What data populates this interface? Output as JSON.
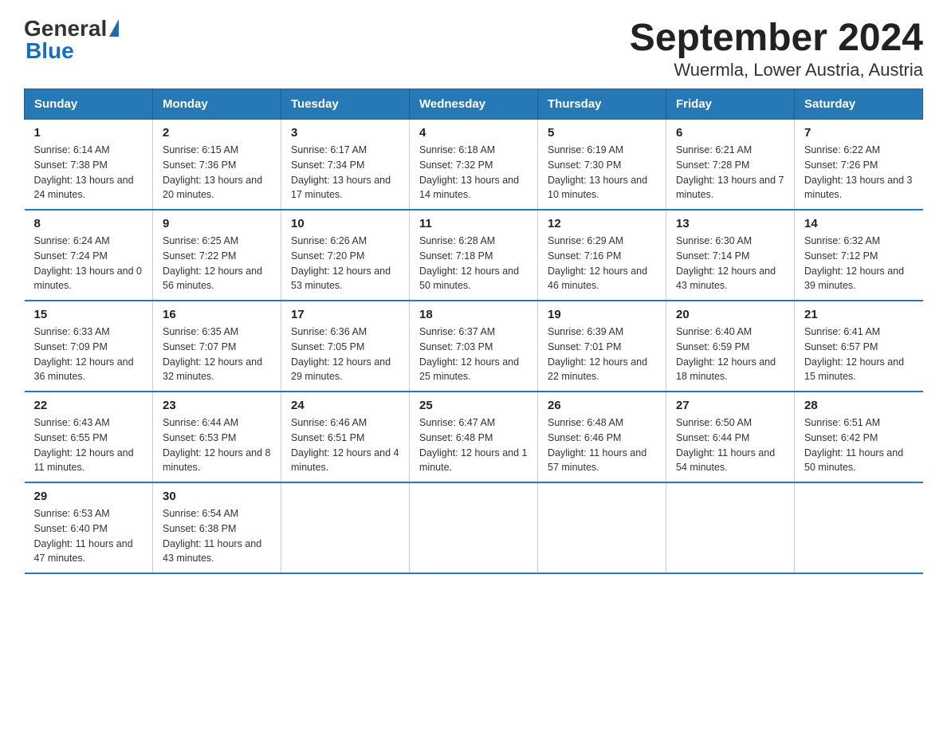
{
  "header": {
    "logo_general": "General",
    "logo_blue": "Blue",
    "title": "September 2024",
    "subtitle": "Wuermla, Lower Austria, Austria"
  },
  "days_of_week": [
    "Sunday",
    "Monday",
    "Tuesday",
    "Wednesday",
    "Thursday",
    "Friday",
    "Saturday"
  ],
  "weeks": [
    [
      {
        "day": "1",
        "sunrise": "Sunrise: 6:14 AM",
        "sunset": "Sunset: 7:38 PM",
        "daylight": "Daylight: 13 hours and 24 minutes."
      },
      {
        "day": "2",
        "sunrise": "Sunrise: 6:15 AM",
        "sunset": "Sunset: 7:36 PM",
        "daylight": "Daylight: 13 hours and 20 minutes."
      },
      {
        "day": "3",
        "sunrise": "Sunrise: 6:17 AM",
        "sunset": "Sunset: 7:34 PM",
        "daylight": "Daylight: 13 hours and 17 minutes."
      },
      {
        "day": "4",
        "sunrise": "Sunrise: 6:18 AM",
        "sunset": "Sunset: 7:32 PM",
        "daylight": "Daylight: 13 hours and 14 minutes."
      },
      {
        "day": "5",
        "sunrise": "Sunrise: 6:19 AM",
        "sunset": "Sunset: 7:30 PM",
        "daylight": "Daylight: 13 hours and 10 minutes."
      },
      {
        "day": "6",
        "sunrise": "Sunrise: 6:21 AM",
        "sunset": "Sunset: 7:28 PM",
        "daylight": "Daylight: 13 hours and 7 minutes."
      },
      {
        "day": "7",
        "sunrise": "Sunrise: 6:22 AM",
        "sunset": "Sunset: 7:26 PM",
        "daylight": "Daylight: 13 hours and 3 minutes."
      }
    ],
    [
      {
        "day": "8",
        "sunrise": "Sunrise: 6:24 AM",
        "sunset": "Sunset: 7:24 PM",
        "daylight": "Daylight: 13 hours and 0 minutes."
      },
      {
        "day": "9",
        "sunrise": "Sunrise: 6:25 AM",
        "sunset": "Sunset: 7:22 PM",
        "daylight": "Daylight: 12 hours and 56 minutes."
      },
      {
        "day": "10",
        "sunrise": "Sunrise: 6:26 AM",
        "sunset": "Sunset: 7:20 PM",
        "daylight": "Daylight: 12 hours and 53 minutes."
      },
      {
        "day": "11",
        "sunrise": "Sunrise: 6:28 AM",
        "sunset": "Sunset: 7:18 PM",
        "daylight": "Daylight: 12 hours and 50 minutes."
      },
      {
        "day": "12",
        "sunrise": "Sunrise: 6:29 AM",
        "sunset": "Sunset: 7:16 PM",
        "daylight": "Daylight: 12 hours and 46 minutes."
      },
      {
        "day": "13",
        "sunrise": "Sunrise: 6:30 AM",
        "sunset": "Sunset: 7:14 PM",
        "daylight": "Daylight: 12 hours and 43 minutes."
      },
      {
        "day": "14",
        "sunrise": "Sunrise: 6:32 AM",
        "sunset": "Sunset: 7:12 PM",
        "daylight": "Daylight: 12 hours and 39 minutes."
      }
    ],
    [
      {
        "day": "15",
        "sunrise": "Sunrise: 6:33 AM",
        "sunset": "Sunset: 7:09 PM",
        "daylight": "Daylight: 12 hours and 36 minutes."
      },
      {
        "day": "16",
        "sunrise": "Sunrise: 6:35 AM",
        "sunset": "Sunset: 7:07 PM",
        "daylight": "Daylight: 12 hours and 32 minutes."
      },
      {
        "day": "17",
        "sunrise": "Sunrise: 6:36 AM",
        "sunset": "Sunset: 7:05 PM",
        "daylight": "Daylight: 12 hours and 29 minutes."
      },
      {
        "day": "18",
        "sunrise": "Sunrise: 6:37 AM",
        "sunset": "Sunset: 7:03 PM",
        "daylight": "Daylight: 12 hours and 25 minutes."
      },
      {
        "day": "19",
        "sunrise": "Sunrise: 6:39 AM",
        "sunset": "Sunset: 7:01 PM",
        "daylight": "Daylight: 12 hours and 22 minutes."
      },
      {
        "day": "20",
        "sunrise": "Sunrise: 6:40 AM",
        "sunset": "Sunset: 6:59 PM",
        "daylight": "Daylight: 12 hours and 18 minutes."
      },
      {
        "day": "21",
        "sunrise": "Sunrise: 6:41 AM",
        "sunset": "Sunset: 6:57 PM",
        "daylight": "Daylight: 12 hours and 15 minutes."
      }
    ],
    [
      {
        "day": "22",
        "sunrise": "Sunrise: 6:43 AM",
        "sunset": "Sunset: 6:55 PM",
        "daylight": "Daylight: 12 hours and 11 minutes."
      },
      {
        "day": "23",
        "sunrise": "Sunrise: 6:44 AM",
        "sunset": "Sunset: 6:53 PM",
        "daylight": "Daylight: 12 hours and 8 minutes."
      },
      {
        "day": "24",
        "sunrise": "Sunrise: 6:46 AM",
        "sunset": "Sunset: 6:51 PM",
        "daylight": "Daylight: 12 hours and 4 minutes."
      },
      {
        "day": "25",
        "sunrise": "Sunrise: 6:47 AM",
        "sunset": "Sunset: 6:48 PM",
        "daylight": "Daylight: 12 hours and 1 minute."
      },
      {
        "day": "26",
        "sunrise": "Sunrise: 6:48 AM",
        "sunset": "Sunset: 6:46 PM",
        "daylight": "Daylight: 11 hours and 57 minutes."
      },
      {
        "day": "27",
        "sunrise": "Sunrise: 6:50 AM",
        "sunset": "Sunset: 6:44 PM",
        "daylight": "Daylight: 11 hours and 54 minutes."
      },
      {
        "day": "28",
        "sunrise": "Sunrise: 6:51 AM",
        "sunset": "Sunset: 6:42 PM",
        "daylight": "Daylight: 11 hours and 50 minutes."
      }
    ],
    [
      {
        "day": "29",
        "sunrise": "Sunrise: 6:53 AM",
        "sunset": "Sunset: 6:40 PM",
        "daylight": "Daylight: 11 hours and 47 minutes."
      },
      {
        "day": "30",
        "sunrise": "Sunrise: 6:54 AM",
        "sunset": "Sunset: 6:38 PM",
        "daylight": "Daylight: 11 hours and 43 minutes."
      },
      null,
      null,
      null,
      null,
      null
    ]
  ]
}
